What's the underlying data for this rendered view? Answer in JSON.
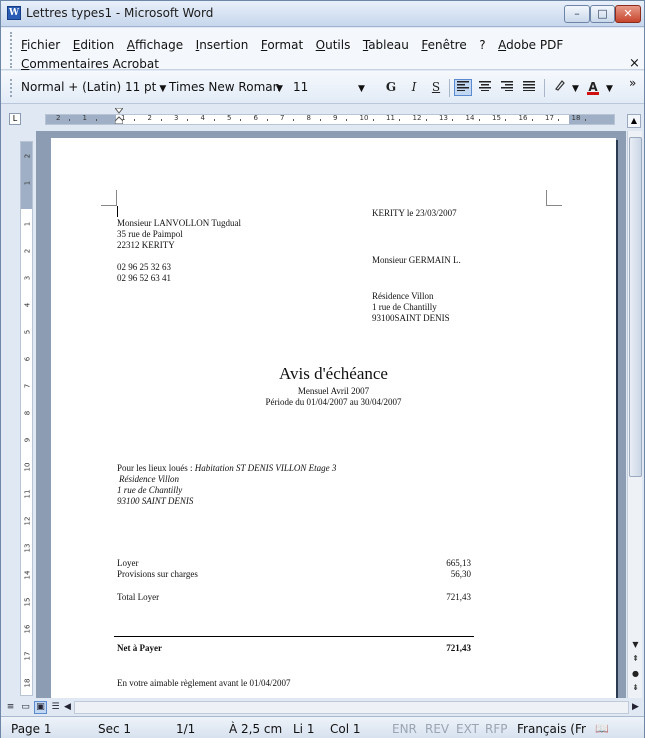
{
  "window": {
    "title": "Lettres types1 - Microsoft Word",
    "app_icon": "W",
    "controls": {
      "minimize": "–",
      "maximize": "□",
      "close": "✕"
    }
  },
  "menu": {
    "row1": [
      "Fichier",
      "Edition",
      "Affichage",
      "Insertion",
      "Format",
      "Outils",
      "Tableau",
      "Fenêtre",
      "?",
      "Adobe PDF"
    ],
    "row2": [
      "Commentaires Acrobat"
    ],
    "close_doc": "×"
  },
  "toolbar": {
    "style": "Normal + (Latin) 11 pt",
    "font": "Times New Roman",
    "size": "11",
    "bold": "G",
    "italic": "I",
    "underline": "S",
    "overflow": "»",
    "font_color": "#d01010"
  },
  "ruler": {
    "h_numbers": [
      "2",
      "1",
      "1",
      "2",
      "3",
      "4",
      "5",
      "6",
      "7",
      "8",
      "9",
      "10",
      "11",
      "12",
      "13",
      "14",
      "15",
      "16",
      "17",
      "18"
    ],
    "v_numbers": [
      "2",
      "1",
      "1",
      "2",
      "3",
      "4",
      "5",
      "6",
      "7",
      "8",
      "9",
      "10",
      "11",
      "12",
      "13",
      "14",
      "15",
      "16",
      "17",
      "18"
    ]
  },
  "document": {
    "sender": {
      "name": "Monsieur LANVOLLON Tugdual",
      "street": "35 rue de Paimpol",
      "city": "22312 KERITY",
      "phone1": "02 96 25 32 63",
      "phone2": "02 96 52 63 41"
    },
    "date_line": "KERITY le 23/03/2007",
    "recipient": {
      "name": "Monsieur GERMAIN L.",
      "residence": "Résidence Villon",
      "street": "1 rue de Chantilly",
      "city": "93100SAINT DENIS"
    },
    "heading": "Avis d'échéance",
    "sub1": "Mensuel Avril 2007",
    "sub2": "Période du 01/04/2007 au 30/04/2007",
    "premises_label": "Pour les lieux loués :",
    "premises_value": "Habitation ST DENIS VILLON Etage 3",
    "premises_addr": [
      "Résidence Villon",
      "1 rue de Chantilly",
      "93100 SAINT DENIS"
    ],
    "lines": [
      {
        "label": "Loyer",
        "amount": "665,13"
      },
      {
        "label": "Provisions sur charges",
        "amount": "56,30"
      }
    ],
    "total_label": "Total Loyer",
    "total_amount": "721,43",
    "net_label": "Net à Payer",
    "net_amount": "721,43",
    "footer": "En votre aimable règlement avant le 01/04/2007"
  },
  "status": {
    "page": "Page 1",
    "sec": "Sec 1",
    "pages": "1/1",
    "at": "À 2,5 cm",
    "line": "Li 1",
    "col": "Col 1",
    "enr": "ENR",
    "rev": "REV",
    "ext": "EXT",
    "rfp": "RFP",
    "lang": "Français (Fr"
  }
}
